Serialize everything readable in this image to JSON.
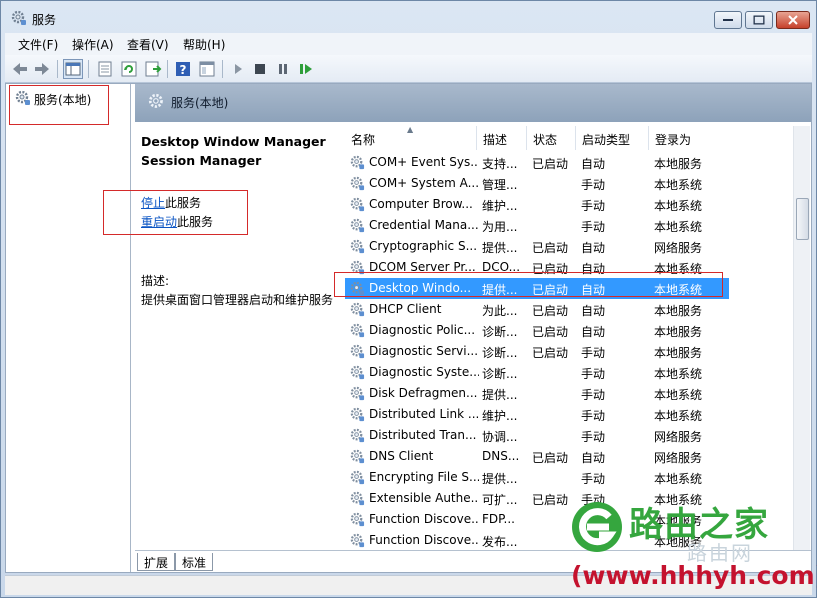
{
  "window": {
    "title": "服务"
  },
  "menu": [
    "文件(F)",
    "操作(A)",
    "查看(V)",
    "帮助(H)"
  ],
  "tree": {
    "root_label": "服务(本地)"
  },
  "content": {
    "header_title": "服务(本地)",
    "selected_service": {
      "name_line1": "Desktop Window Manager",
      "name_line2": "Session Manager"
    },
    "actions": {
      "stop_link": "停止",
      "stop_suffix": "此服务",
      "restart_link": "重启动",
      "restart_suffix": "此服务"
    },
    "description_label": "描述:",
    "description_text": "提供桌面窗口管理器启动和维护服务"
  },
  "columns": [
    "名称",
    "描述",
    "状态",
    "启动类型",
    "登录为"
  ],
  "services": [
    {
      "name": "COM+ Event Sys...",
      "desc": "支持...",
      "state": "已启动",
      "startup": "自动",
      "logon": "本地服务"
    },
    {
      "name": "COM+ System A...",
      "desc": "管理...",
      "state": "",
      "startup": "手动",
      "logon": "本地系统"
    },
    {
      "name": "Computer Brow...",
      "desc": "维护...",
      "state": "",
      "startup": "手动",
      "logon": "本地系统"
    },
    {
      "name": "Credential Mana...",
      "desc": "为用...",
      "state": "",
      "startup": "手动",
      "logon": "本地系统"
    },
    {
      "name": "Cryptographic S...",
      "desc": "提供...",
      "state": "已启动",
      "startup": "自动",
      "logon": "网络服务"
    },
    {
      "name": "DCOM Server Pr...",
      "desc": "DCO...",
      "state": "已启动",
      "startup": "自动",
      "logon": "本地系统"
    },
    {
      "name": "Desktop Windo...",
      "desc": "提供...",
      "state": "已启动",
      "startup": "自动",
      "logon": "本地系统",
      "selected": true
    },
    {
      "name": "DHCP Client",
      "desc": "为此...",
      "state": "已启动",
      "startup": "自动",
      "logon": "本地服务"
    },
    {
      "name": "Diagnostic Polic...",
      "desc": "诊断...",
      "state": "已启动",
      "startup": "自动",
      "logon": "本地服务"
    },
    {
      "name": "Diagnostic Servi...",
      "desc": "诊断...",
      "state": "已启动",
      "startup": "手动",
      "logon": "本地服务"
    },
    {
      "name": "Diagnostic Syste...",
      "desc": "诊断...",
      "state": "",
      "startup": "手动",
      "logon": "本地系统"
    },
    {
      "name": "Disk Defragmen...",
      "desc": "提供...",
      "state": "",
      "startup": "手动",
      "logon": "本地系统"
    },
    {
      "name": "Distributed Link ...",
      "desc": "维护...",
      "state": "",
      "startup": "手动",
      "logon": "本地系统"
    },
    {
      "name": "Distributed Tran...",
      "desc": "协调...",
      "state": "",
      "startup": "手动",
      "logon": "网络服务"
    },
    {
      "name": "DNS Client",
      "desc": "DNS...",
      "state": "已启动",
      "startup": "自动",
      "logon": "网络服务"
    },
    {
      "name": "Encrypting File S...",
      "desc": "提供...",
      "state": "",
      "startup": "手动",
      "logon": "本地系统"
    },
    {
      "name": "Extensible Authe...",
      "desc": "可扩...",
      "state": "已启动",
      "startup": "手动",
      "logon": "本地系统"
    },
    {
      "name": "Function Discove...",
      "desc": "FDP...",
      "state": "",
      "startup": "手动",
      "logon": "本地服务"
    },
    {
      "name": "Function Discove...",
      "desc": "发布...",
      "state": "",
      "startup": "手动",
      "logon": "本地服务"
    }
  ],
  "tabs": [
    "扩展",
    "标准"
  ],
  "watermark": {
    "brand": "路由之家",
    "ghost": "路由网",
    "url": "(www.hhhyh.com)"
  },
  "colors": {
    "selection": "#3399ff",
    "link": "#0b55c4",
    "annotation_red": "#d42a2a",
    "brand_green": "#35a63e",
    "brand_red": "#c4122e"
  }
}
